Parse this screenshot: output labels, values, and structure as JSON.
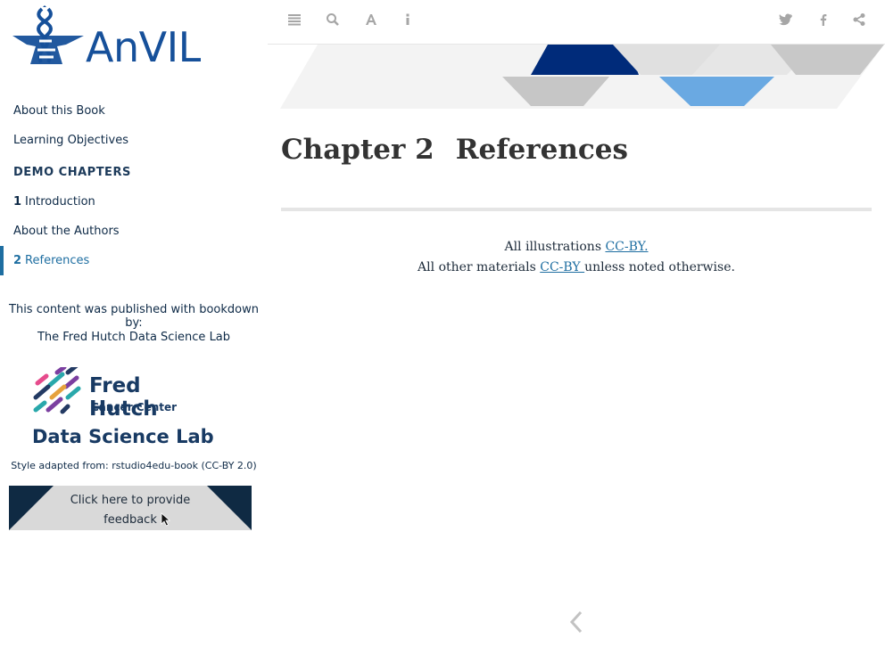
{
  "sidebar": {
    "logo_text": "AnVIL",
    "nav": [
      {
        "num": "",
        "label": "About this Book"
      },
      {
        "num": "",
        "label": "Learning Objectives"
      }
    ],
    "section_header": "DEMO CHAPTERS",
    "chapters": [
      {
        "num": "1",
        "label": "Introduction"
      },
      {
        "num": "",
        "label": "About the Authors"
      },
      {
        "num": "2",
        "label": "References"
      }
    ],
    "published_text": "This content was published with bookdown by:",
    "lab_name": "The Fred Hutch Data Science Lab",
    "fh_logo": {
      "title": "Fred Hutch",
      "subtitle": "Cancer Center",
      "lab": "Data Science Lab"
    },
    "style_note": "Style adapted from: rstudio4edu-book (CC-BY 2.0)",
    "feedback_label": "Click here to provide feedback"
  },
  "toolbar": {
    "icons": [
      "menu-icon",
      "search-icon",
      "font-icon",
      "info-icon",
      "twitter-icon",
      "facebook-icon",
      "share-icon"
    ]
  },
  "main": {
    "chapter_number": "Chapter 2",
    "chapter_title": "References",
    "license_line1_prefix": "All illustrations ",
    "license_line1_link": "CC-BY.",
    "license_line2_prefix": "All other materials ",
    "license_line2_link": "CC-BY ",
    "license_line2_suffix": "unless noted otherwise."
  },
  "colors": {
    "accent": "#1e6ea1",
    "navy": "#0f2a43",
    "banner_dark": "#002b7a",
    "banner_light": "#6aa9e2",
    "banner_gray": "#c8c8c8"
  }
}
